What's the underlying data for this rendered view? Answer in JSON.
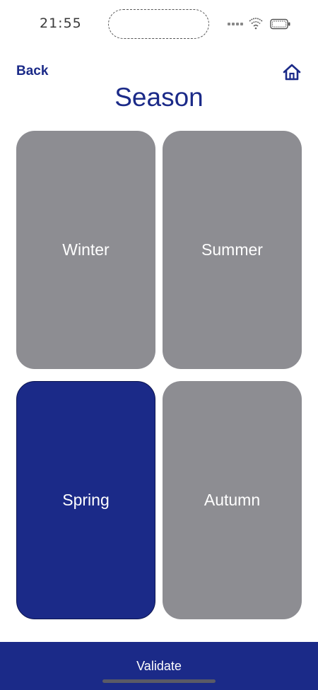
{
  "status_bar": {
    "time": "21:55",
    "icons": [
      "signal-icon",
      "wifi-icon",
      "battery-icon"
    ]
  },
  "header": {
    "back_label": "Back",
    "home_icon": "home-icon",
    "title": "Season"
  },
  "seasons": [
    {
      "label": "Winter",
      "selected": false
    },
    {
      "label": "Summer",
      "selected": false
    },
    {
      "label": "Spring",
      "selected": true
    },
    {
      "label": "Autumn",
      "selected": false
    }
  ],
  "footer": {
    "validate_label": "Validate"
  },
  "colors": {
    "accent": "#1b2a88",
    "tile_default": "#8d8d92",
    "tile_text": "#ffffff",
    "background": "#ffffff"
  }
}
